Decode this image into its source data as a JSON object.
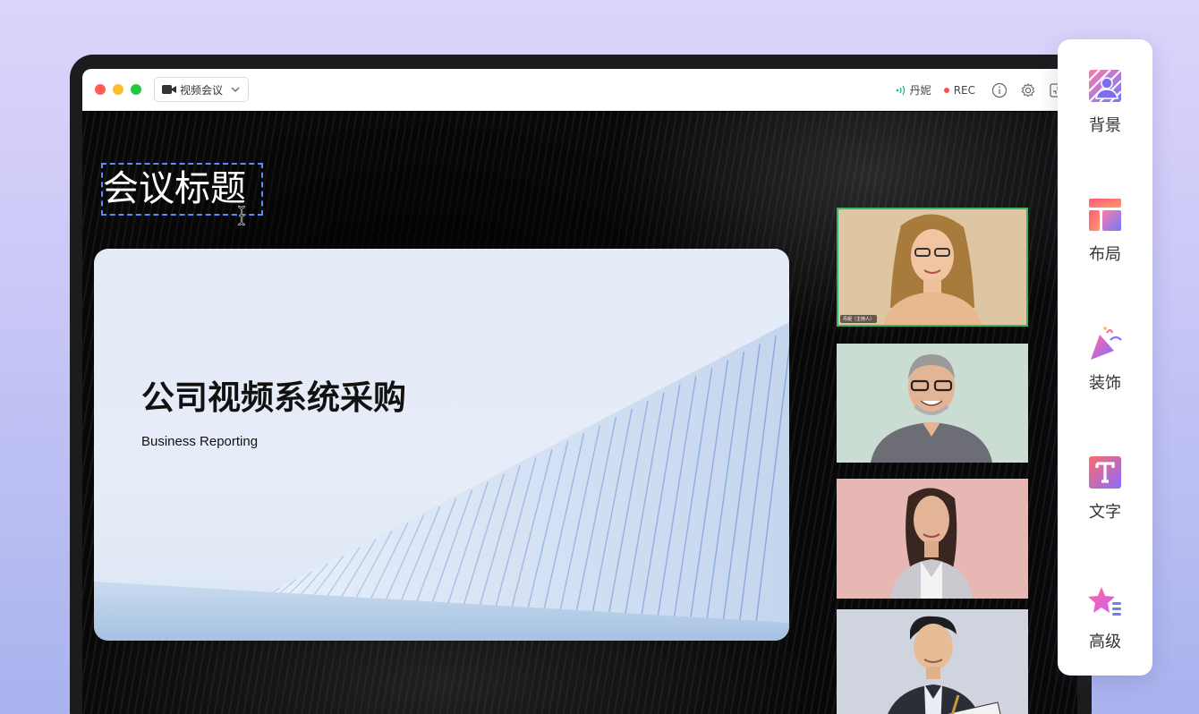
{
  "window": {
    "meeting_selector": "视频会议",
    "speaker_name": "丹妮",
    "rec_label": "REC"
  },
  "stage": {
    "meeting_title": "会议标题"
  },
  "slide": {
    "title": "公司视频系统采购",
    "subtitle": "Business Reporting"
  },
  "participants": [
    {
      "label": "丹妮（主持人）",
      "bg": "#ddc6a1",
      "active": true
    },
    {
      "label": "",
      "bg": "#cbdcd3",
      "active": false
    },
    {
      "label": "",
      "bg": "#e7b7b3",
      "active": false
    },
    {
      "label": "",
      "bg": "#d0d4df",
      "active": false
    }
  ],
  "panel": {
    "items": [
      {
        "label": "背景",
        "icon": "background-icon"
      },
      {
        "label": "布局",
        "icon": "layout-icon"
      },
      {
        "label": "装饰",
        "icon": "decoration-icon"
      },
      {
        "label": "文字",
        "icon": "text-icon"
      },
      {
        "label": "高级",
        "icon": "advanced-icon"
      }
    ]
  },
  "colors": {
    "accent_blue": "#5a8cff",
    "active_speaker_border": "#3cb371",
    "rec_red": "#ff4d4f"
  }
}
